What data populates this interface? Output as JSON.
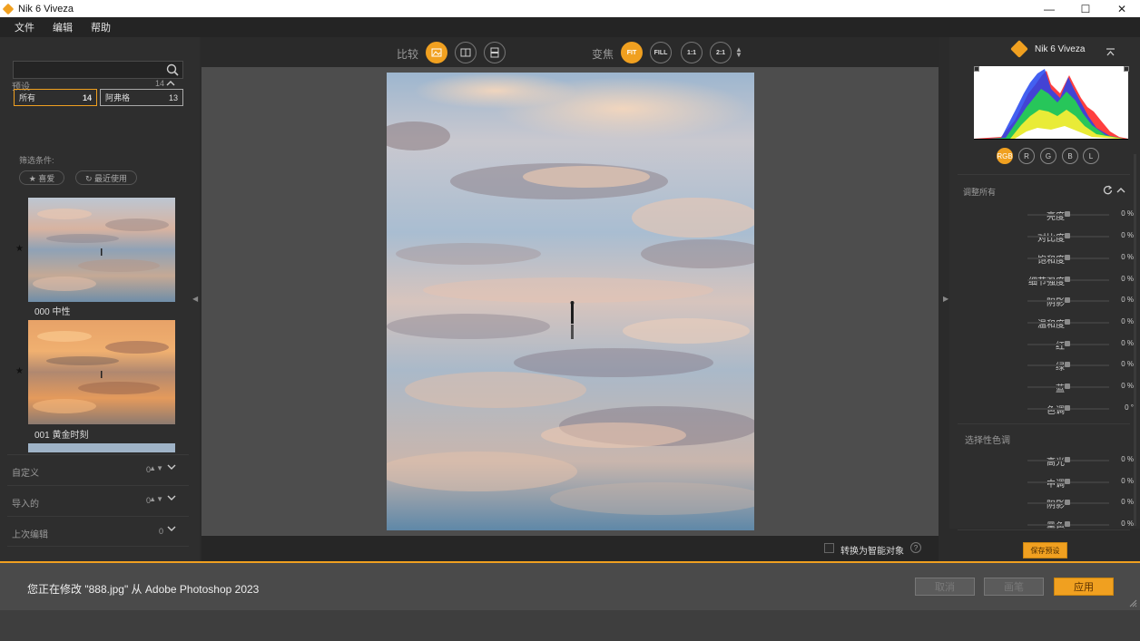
{
  "window": {
    "title": "Nik 6 Viveza",
    "controls": [
      "—",
      "☐",
      "✕"
    ]
  },
  "menu": [
    "文件",
    "编辑",
    "帮助"
  ],
  "left": {
    "presets_header": "预设",
    "presets_count": "14",
    "tabs": [
      {
        "label": "所有",
        "count": "14"
      },
      {
        "label": "阿弗格",
        "count": "13"
      }
    ],
    "filter_label": "筛选条件:",
    "filter_pills": [
      "★ 喜爱",
      "↻ 最近使用"
    ],
    "presets": [
      {
        "name": "000 中性"
      },
      {
        "name": "001 黄金时刻"
      }
    ],
    "sections": [
      {
        "label": "自定义",
        "count": "0"
      },
      {
        "label": "导入的",
        "count": "0"
      },
      {
        "label": "上次编辑",
        "count": "0"
      }
    ]
  },
  "toolbar": {
    "compare_label": "比较",
    "zoom_label": "变焦",
    "zoom_buttons": [
      "FIT",
      "FILL",
      "1:1",
      "2:1"
    ]
  },
  "canvas": {
    "smart_object_label": "转换为智能对象",
    "help": "?"
  },
  "right": {
    "brand": "Nik 6 Viveza",
    "channels": [
      "RGB",
      "R",
      "G",
      "B",
      "L"
    ],
    "adjust_header": "调整所有",
    "sliders": [
      {
        "label": "亮度",
        "value": "0 %"
      },
      {
        "label": "对比度",
        "value": "0 %"
      },
      {
        "label": "饱和度",
        "value": "0 %"
      },
      {
        "label": "细节强度",
        "value": "0 %"
      },
      {
        "label": "阴影",
        "value": "0 %"
      },
      {
        "label": "温和度",
        "value": "0 %"
      },
      {
        "label": "红",
        "value": "0 %"
      },
      {
        "label": "绿",
        "value": "0 %"
      },
      {
        "label": "蓝",
        "value": "0 %"
      },
      {
        "label": "色调",
        "value": "0 °"
      }
    ],
    "selective_header": "选择性色调",
    "selective_sliders": [
      {
        "label": "高光",
        "value": "0 %"
      },
      {
        "label": "中调",
        "value": "0 %"
      },
      {
        "label": "阴影",
        "value": "0 %"
      },
      {
        "label": "黑色",
        "value": "0 %"
      }
    ],
    "save_preset": "保存预设"
  },
  "footer": {
    "message": "您正在修改 \"888.jpg\" 从 Adobe Photoshop 2023",
    "cancel": "取消",
    "brush": "画笔",
    "apply": "应用"
  },
  "colors": {
    "accent": "#f0a020",
    "panel": "#2e2e2e",
    "canvas": "#4d4d4d"
  }
}
